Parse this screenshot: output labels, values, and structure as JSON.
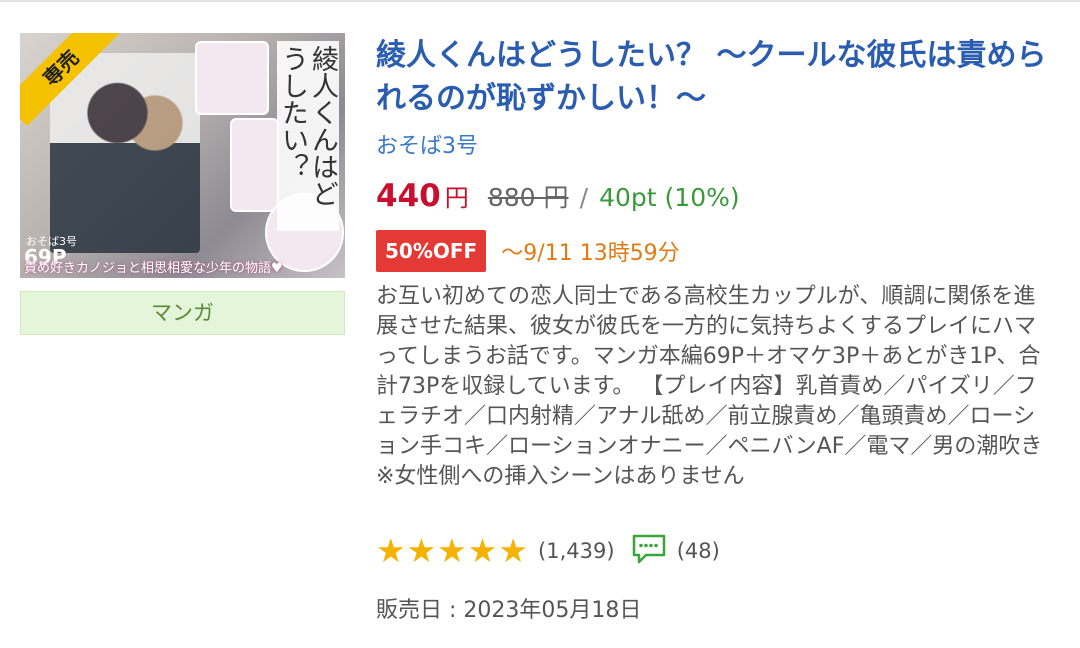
{
  "product": {
    "exclusive_badge": "専売",
    "cover": {
      "vertical_title": "綾人くんはどうしたい？",
      "pages": "69P",
      "author": "おそば3号",
      "tagline": "責め好きカノジョと相思相愛な少年の物語♥"
    },
    "genre_label": "マンガ",
    "title": "綾人くんはどうしたい？ 〜クールな彼氏は責められるのが恥ずかしい！〜",
    "circle": "おそば3号",
    "price": "440",
    "price_unit": "円",
    "original_price": "880 円",
    "separator": "/",
    "points": "40pt (10%)",
    "discount_badge": "50%OFF",
    "sale_until": "〜9/11 13時59分",
    "description": "お互い初めての恋人同士である高校生カップルが、順調に関係を進展させた結果、彼女が彼氏を一方的に気持ちよくするプレイにハマってしまうお話です。マンガ本編69P＋オマケ3P＋あとがき1P、合計73Pを収録しています。 【プレイ内容】乳首責め／パイズリ／フェラチオ／口内射精／アナル舐め／前立腺責め／亀頭責め／ローション手コキ／ローションオナニー／ペニバンAF／電マ／男の潮吹き　※女性側への挿入シーンはありません",
    "rating_stars": "★★★★★",
    "rating_value": 5,
    "rating_count": "(1,439)",
    "review_count": "(48)",
    "release_date": "販売日 : 2023年05月18日"
  },
  "icons": [
    "comment-icon",
    "star-icon"
  ],
  "colors": {
    "title": "#2a5db0",
    "price": "#c8102e",
    "points": "#3a9a3a",
    "badge": "#e53935",
    "sale_until": "#e07b14",
    "stars": "#f5b301",
    "genre_bg": "#e5f5d9",
    "ribbon": "#f4c200"
  }
}
